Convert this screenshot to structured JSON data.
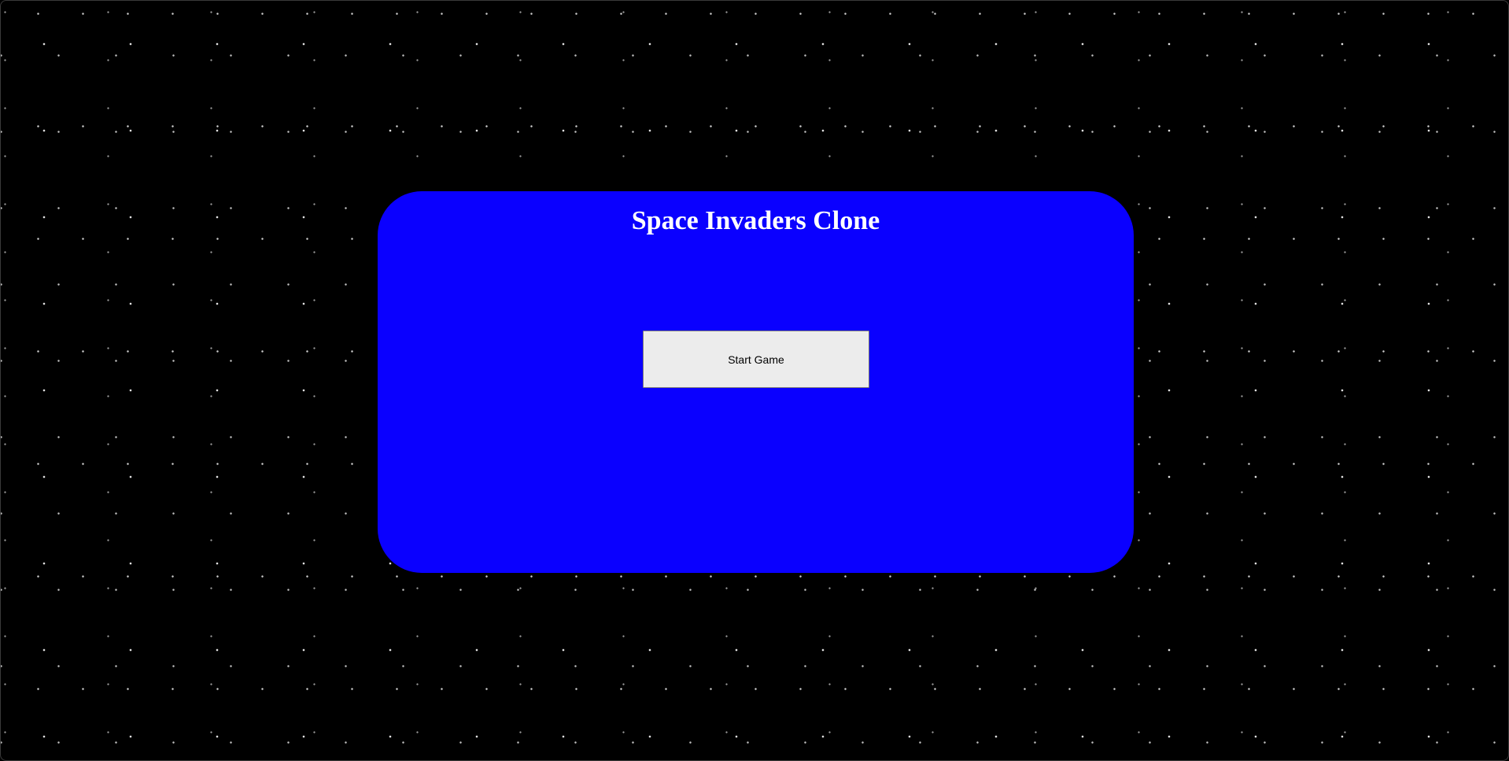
{
  "game": {
    "title": "Space Invaders Clone",
    "start_button_label": "Start Game"
  },
  "colors": {
    "background": "#000000",
    "panel": "#0a00ff",
    "title_text": "#ffffff",
    "button_bg": "#ececec"
  },
  "icons": {
    "background": "starfield"
  }
}
